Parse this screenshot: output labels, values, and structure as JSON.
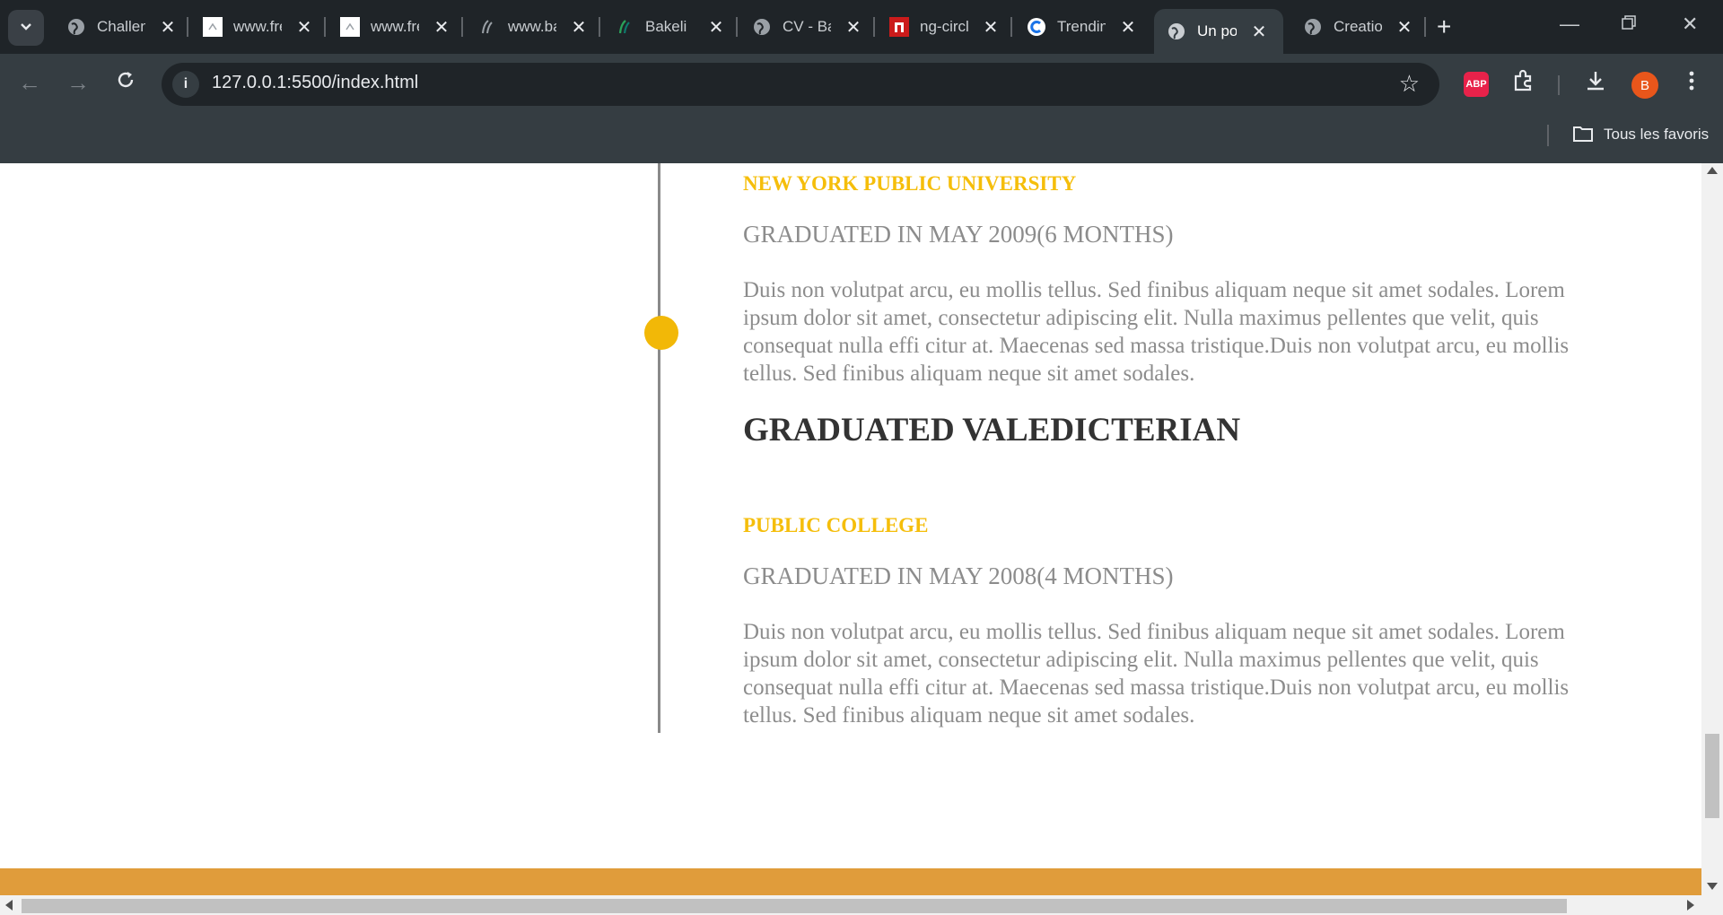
{
  "browser": {
    "tabs": [
      {
        "title": "Challenge",
        "icon": "globe-icon"
      },
      {
        "title": "www.freepik",
        "icon": "freepik-icon"
      },
      {
        "title": "www.freepik",
        "icon": "freepik-icon"
      },
      {
        "title": "www.bakeli",
        "icon": "bakeli-icon"
      },
      {
        "title": "Bakeli",
        "icon": "bakeli-icon"
      },
      {
        "title": "CV - Bakeli",
        "icon": "globe-icon"
      },
      {
        "title": "ng-circle",
        "icon": "npm-icon"
      },
      {
        "title": "Trending",
        "icon": "c-icon"
      },
      {
        "title": "Un portfolio",
        "icon": "globe-icon",
        "active": true
      },
      {
        "title": "Creation",
        "icon": "globe-icon"
      }
    ],
    "url": "127.0.0.1:5500/index.html",
    "abp_label": "ABP",
    "avatar_letter": "B",
    "bookmarks_label": "Tous les favoris"
  },
  "page": {
    "entries": [
      {
        "institution": "NEW YORK PUBLIC UNIVERSITY",
        "graduated": "GRADUATED IN MAY 2009(6 MONTHS)",
        "description": "Duis non volutpat arcu, eu mollis tellus. Sed finibus aliquam neque sit amet sodales. Lorem ipsum dolor sit amet, consectetur adipiscing elit. Nulla maximus pellentes que velit, quis consequat nulla effi citur at. Maecenas sed massa tristique.Duis non volutpat arcu, eu mollis tellus. Sed finibus aliquam neque sit amet sodales.",
        "heading": "GRADUATED VALEDICTERIAN"
      },
      {
        "institution": "PUBLIC COLLEGE",
        "graduated": "GRADUATED IN MAY 2008(4 MONTHS)",
        "description": "Duis non volutpat arcu, eu mollis tellus. Sed finibus aliquam neque sit amet sodales. Lorem ipsum dolor sit amet, consectetur adipiscing elit. Nulla maximus pellentes que velit, quis consequat nulla effi citur at. Maecenas sed massa tristique.Duis non volutpat arcu, eu mollis tellus. Sed finibus aliquam neque sit amet sodales."
      }
    ]
  },
  "colors": {
    "accent_yellow": "#f5be0b",
    "timeline_dot": "#f2b807",
    "footer_orange": "#e09c3b",
    "body_text_grey": "#8c8c8c",
    "heading_dark": "#333333"
  }
}
